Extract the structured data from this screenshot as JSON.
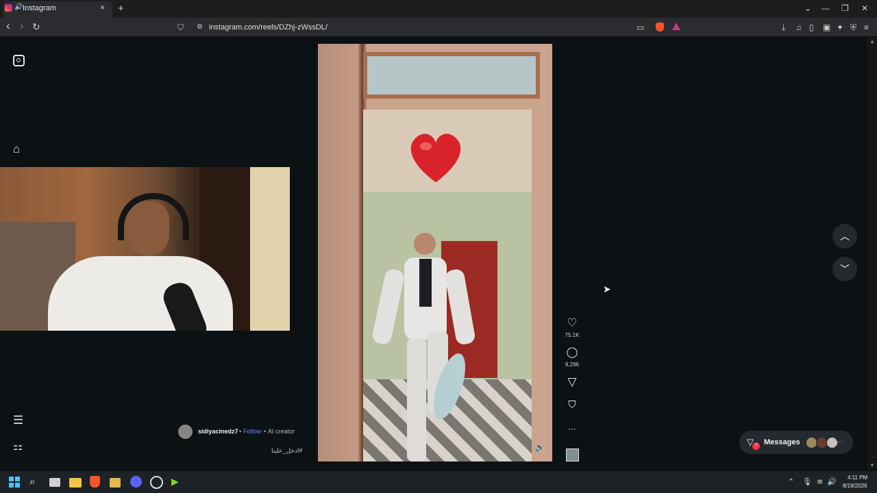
{
  "browser": {
    "tab": {
      "title": "Instagram",
      "close_glyph": "×",
      "favicon": "instagram-icon"
    },
    "new_tab_glyph": "+",
    "window_controls": {
      "dropdown": "⌄",
      "minimize": "—",
      "restore": "❐",
      "close": "✕"
    },
    "nav": {
      "back": "‹",
      "forward": "›",
      "reload": "↻"
    },
    "url": "instagram.com/reels/DZhj-zWssDL/",
    "colors": {
      "tabbar": "#1c1d1f",
      "toolbar": "#2b2c2f",
      "brave": "#fb542b"
    }
  },
  "sidebar": {
    "items": [
      {
        "name": "instagram-logo-icon"
      },
      {
        "name": "home-icon",
        "glyph": "⌂"
      },
      {
        "name": "menu-icon",
        "glyph": "☰"
      },
      {
        "name": "apps-icon",
        "glyph": "⚏"
      }
    ]
  },
  "reel": {
    "actions": {
      "like_glyph": "♡",
      "likes": "75.1K",
      "comment_glyph": "◯",
      "comments": "9,296",
      "share_glyph": "▽",
      "save_glyph": "⛉",
      "more_glyph": "···"
    },
    "mute_glyph": "🔈",
    "caption": {
      "username": "sidiyacinedz7",
      "separator": "•",
      "follow": "Follow",
      "label": "AI creator",
      "hashtag": "#ادخل_علينا"
    }
  },
  "navigation": {
    "prev_glyph": "︿",
    "next_glyph": "﹀"
  },
  "messages": {
    "label": "Messages",
    "badge": "7",
    "more": "···",
    "accent": "#ff3040"
  },
  "taskbar": {
    "clock": {
      "time": "4:11 PM",
      "date": "8/19/2026"
    },
    "tray": {
      "chevron": "⌃",
      "mic": "🎙",
      "wifi": "≋",
      "volume": "🔊"
    },
    "apps": [
      "windows-start-icon",
      "search-icon",
      "task-view-icon",
      "file-explorer-icon",
      "brave-icon",
      "media-icon",
      "discord-icon",
      "obs-icon",
      "app-icon"
    ]
  }
}
